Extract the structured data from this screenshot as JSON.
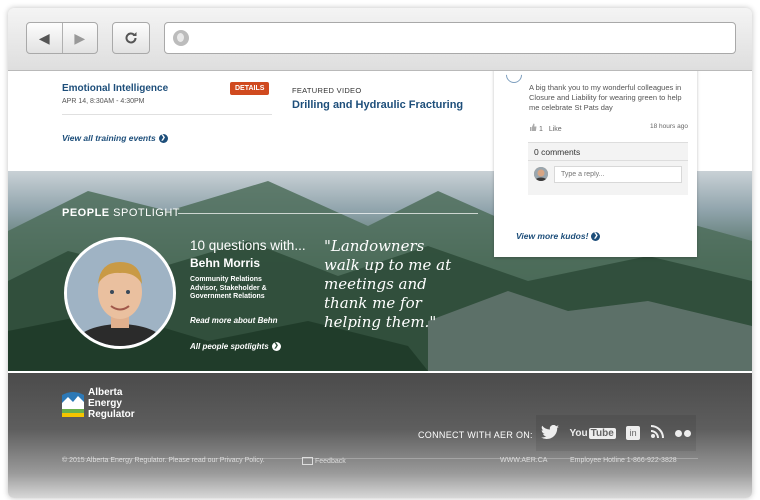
{
  "browser": {
    "back_glyph": "◀",
    "forward_glyph": "▶",
    "reload_icon": "reload-icon",
    "url": ""
  },
  "training": {
    "event_title": "Emotional Intelligence",
    "event_date": "APR 14, 8:30AM - 4:30PM",
    "details_label": "DETAILS",
    "view_all_label": "View all training events"
  },
  "featured": {
    "label": "FEATURED VIDEO",
    "title": "Drilling and Hydraulic Fracturing"
  },
  "kudos": {
    "message": "A big thank you to my wonderful colleagues in Closure and Liability for wearing green to help me celebrate St Pats day",
    "likes_count": "1",
    "like_label": "Like",
    "time_ago": "18 hours ago",
    "comments_label": "0 comments",
    "reply_placeholder": "Type a reply...",
    "view_more_label": "View more kudos!"
  },
  "spotlight": {
    "heading_bold": "PEOPLE",
    "heading_rest": " SPOTLIGHT",
    "questions_title": "10 questions with...",
    "person_name": "Behn Morris",
    "person_role": "Community Relations Advisor, Stakeholder & Government Relations",
    "read_more_label": "Read more about Behn",
    "all_spotlights_label": "All people spotlights",
    "quote": "\"Landowners walk up to me at meetings and thank me for helping them.\""
  },
  "footer": {
    "logo_text": "Alberta Energy Regulator",
    "connect_label": "CONNECT WITH AER ON:",
    "social": {
      "twitter": "twitter-icon",
      "youtube_you": "You",
      "youtube_tube": "Tube",
      "linkedin": "in",
      "blog": "rss-icon",
      "flickr": "flickr-icon"
    },
    "copyright": "© 2015 Alberta Energy Regulator. Please read our Privacy Policy.",
    "feedback_label": "Feedback",
    "website": "WWW.AER.CA",
    "hotline": "Employee Hotline 1-866-922-3828"
  }
}
